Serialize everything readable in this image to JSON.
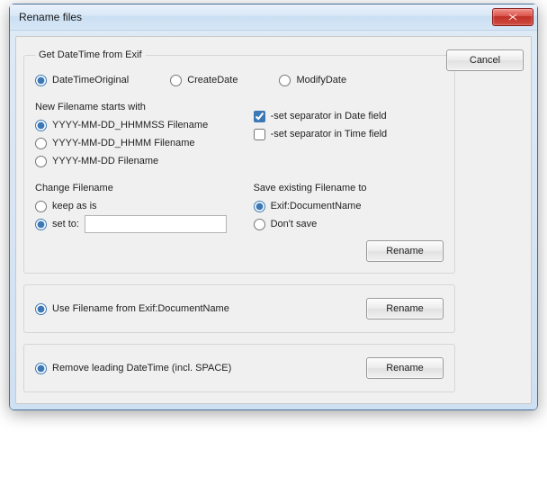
{
  "window": {
    "title": "Rename files"
  },
  "buttons": {
    "cancel": "Cancel",
    "rename": "Rename"
  },
  "exif": {
    "section_title": "Get DateTime from Exif",
    "option_original": "DateTimeOriginal",
    "option_create": "CreateDate",
    "option_modify": "ModifyDate"
  },
  "newname": {
    "section_title": "New Filename starts with",
    "opt_full": "YYYY-MM-DD_HHMMSS Filename",
    "opt_hhmm": "YYYY-MM-DD_HHMM Filename",
    "opt_date": "YYYY-MM-DD Filename"
  },
  "separators": {
    "date_sep": "-set separator in Date field",
    "time_sep": "-set separator in Time field"
  },
  "change": {
    "section_title": "Change Filename",
    "keep": "keep as is",
    "set_to": "set to:",
    "value": ""
  },
  "save": {
    "section_title": "Save existing Filename to",
    "exif_doc": "Exif:DocumentName",
    "dont_save": "Don't save"
  },
  "secondary": {
    "use_exif_doc": "Use Filename from Exif:DocumentName",
    "remove_leading": "Remove leading DateTime (incl. SPACE)"
  }
}
